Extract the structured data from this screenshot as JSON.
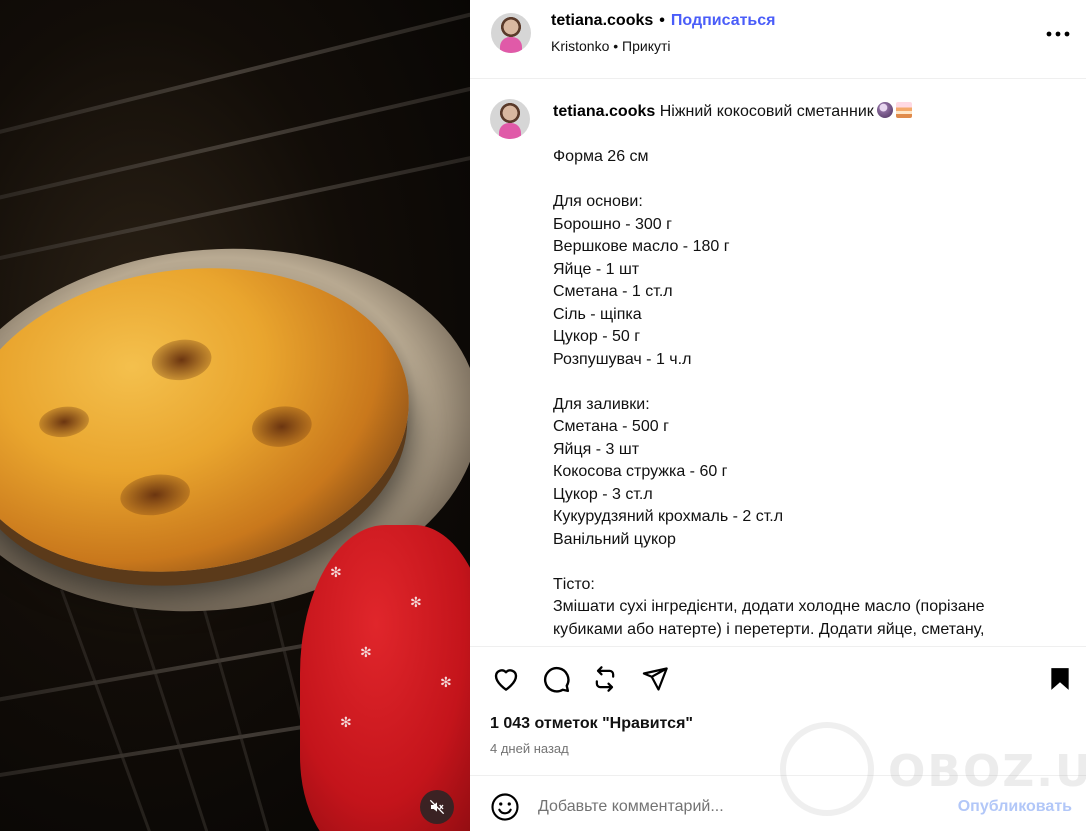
{
  "header": {
    "username": "tetiana.cooks",
    "separator": "•",
    "follow_label": "Подписаться",
    "location": "Kristonko",
    "location_separator": "•",
    "status": "Прикуті"
  },
  "caption": {
    "username": "tetiana.cooks",
    "title": "Ніжний кокосовий сметанник",
    "title_emojis": [
      "coconut-emoji",
      "cake-emoji"
    ],
    "lines": [
      "Форма 26 см",
      "",
      "Для основи:",
      "Борошно - 300 г",
      "Вершкове масло - 180 г",
      "Яйце - 1 шт",
      "Сметана - 1 ст.л",
      "Сіль - щіпка",
      "Цукор - 50 г",
      "Розпушувач - 1 ч.л",
      "",
      "Для заливки:",
      "Сметана - 500 г",
      "Яйця - 3 шт",
      "Кокосова стружка - 60 г",
      "Цукор - 3 ст.л",
      "Кукурудзяний крохмаль - 2 ст.л",
      "Ванільний цукор",
      "",
      "Тісто:",
      "Змішати сухі інгредієнти, додати холодне масло (порізане кубиками або натерте) і перетерти. Додати яйце, сметану,"
    ]
  },
  "actions": {
    "icons": [
      "heart-icon",
      "comment-icon",
      "repost-icon",
      "share-icon",
      "bookmark-icon"
    ]
  },
  "likes_text": "1 043 отметок \"Нравится\"",
  "posted_ago": "4 дней назад",
  "comment": {
    "placeholder": "Добавьте комментарий...",
    "value": "",
    "publish_label": "Опубликовать"
  },
  "media": {
    "mute_icon": "speaker-muted-icon"
  },
  "watermark": {
    "text": "OBOZ.UA"
  },
  "colors": {
    "follow": "#4a5df9",
    "publish_disabled": "#b2c7f8",
    "secondary_text": "#737373"
  }
}
